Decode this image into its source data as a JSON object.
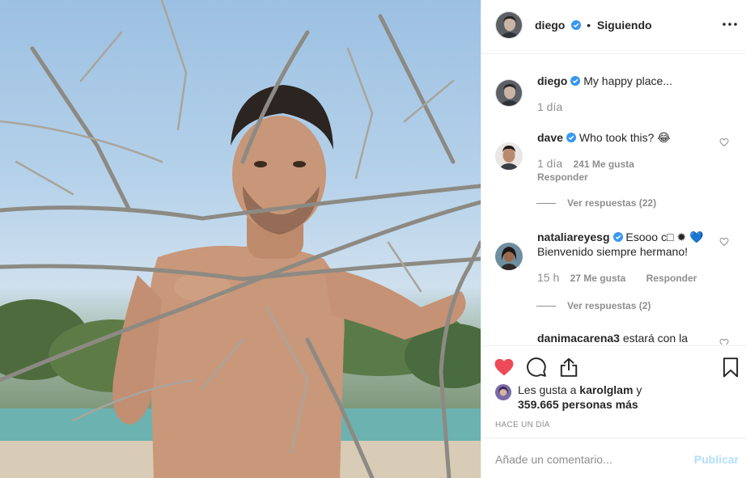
{
  "post": {
    "author": "diego",
    "follow_state": "Siguiendo",
    "caption": "My happy place...",
    "caption_time": "1 día"
  },
  "comments": [
    {
      "user": "dave",
      "text": "Who took this? 😂",
      "time": "1 día",
      "likes": "241 Me gusta",
      "reply": "Responder",
      "view_replies": "Ver respuestas (22)"
    },
    {
      "user": "nataliareyesg",
      "text_line1": "Esooo c□ ✹ 💙",
      "text_line2": "Bienvenido siempre hermano!",
      "time": "15 h",
      "likes": "27 Me gusta",
      "reply": "Responder",
      "view_replies": "Ver respuestas (2)"
    },
    {
      "user": "danimacarena3",
      "text": "estará con la"
    }
  ],
  "likes": {
    "prefix": "Les gusta a",
    "first_user": "karolglam",
    "joiner": "y",
    "others": "359.665 personas más"
  },
  "posted_ago": "HACE UN DÍA",
  "add_comment": {
    "placeholder": "Añade un comentario...",
    "publish_label": "Publicar"
  },
  "icons": {
    "like": "heart-filled-icon",
    "comment": "comment-bubble-icon",
    "share": "share-icon",
    "save": "bookmark-icon",
    "verified": "verified-badge-icon",
    "more": "more-options-icon"
  },
  "colors": {
    "like_red": "#ed4956",
    "verified_blue": "#3897f0",
    "muted": "#8e8e8e",
    "publish_disabled": "#b2dffc"
  }
}
